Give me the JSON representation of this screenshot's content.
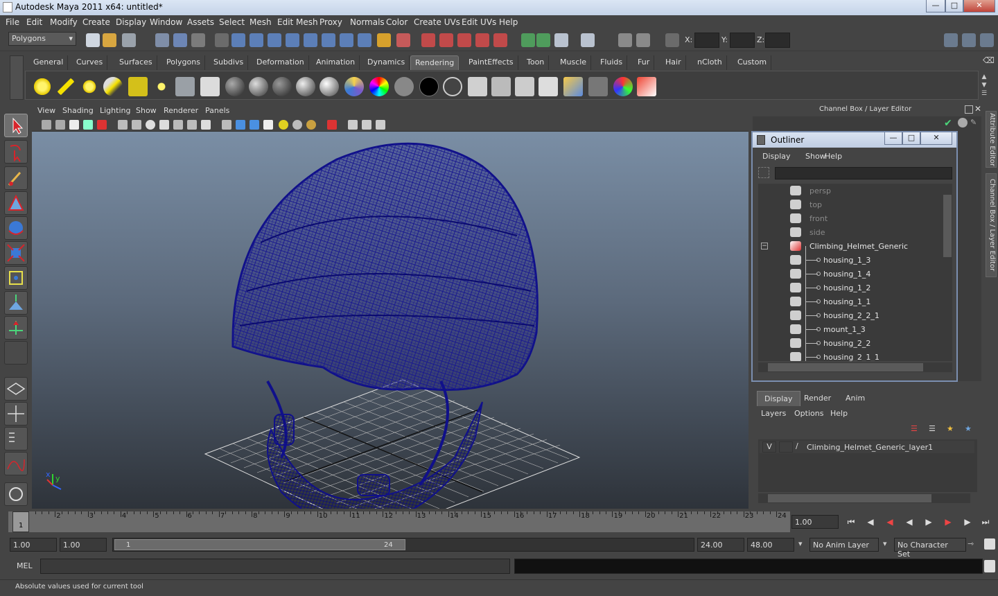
{
  "window": {
    "title": "Autodesk Maya 2011 x64: untitled*"
  },
  "menubar": [
    "File",
    "Edit",
    "Modify",
    "Create",
    "Display",
    "Window",
    "Assets",
    "Select",
    "Mesh",
    "Edit Mesh",
    "Proxy",
    "Normals",
    "Color",
    "Create UVs",
    "Edit UVs",
    "Help"
  ],
  "statusline": {
    "mode": "Polygons",
    "x_label": "X:",
    "y_label": "Y:",
    "z_label": "Z:"
  },
  "shelf_tabs": [
    "General",
    "Curves",
    "Surfaces",
    "Polygons",
    "Subdivs",
    "Deformation",
    "Animation",
    "Dynamics",
    "Rendering",
    "PaintEffects",
    "Toon",
    "Muscle",
    "Fluids",
    "Fur",
    "Hair",
    "nCloth",
    "Custom"
  ],
  "active_shelf": "Rendering",
  "viewport": {
    "menu": [
      "View",
      "Shading",
      "Lighting",
      "Show",
      "Renderer",
      "Panels"
    ],
    "axis_x": "x",
    "axis_y": "y"
  },
  "channel_box": {
    "title": "Channel Box / Layer Editor"
  },
  "outliner": {
    "title": "Outliner",
    "menu": [
      "Display",
      "Show",
      "Help"
    ],
    "items": [
      {
        "name": "persp",
        "dim": true,
        "level": 0
      },
      {
        "name": "top",
        "dim": true,
        "level": 0
      },
      {
        "name": "front",
        "dim": true,
        "level": 0
      },
      {
        "name": "side",
        "dim": true,
        "level": 0
      },
      {
        "name": "Climbing_Helmet_Generic",
        "dim": false,
        "level": 0
      },
      {
        "name": "housing_1_3",
        "dim": false,
        "level": 1
      },
      {
        "name": "housing_1_4",
        "dim": false,
        "level": 1
      },
      {
        "name": "housing_1_2",
        "dim": false,
        "level": 1
      },
      {
        "name": "housing_1_1",
        "dim": false,
        "level": 1
      },
      {
        "name": "housing_2_2_1",
        "dim": false,
        "level": 1
      },
      {
        "name": "mount_1_3",
        "dim": false,
        "level": 1
      },
      {
        "name": "housing_2_2",
        "dim": false,
        "level": 1
      },
      {
        "name": "housing_2_1_1",
        "dim": false,
        "level": 1
      }
    ]
  },
  "side_tabs": [
    "Attribute Editor",
    "Channel Box / Layer Editor"
  ],
  "layer_editor": {
    "tabs": [
      "Display",
      "Render",
      "Anim"
    ],
    "menu": [
      "Layers",
      "Options",
      "Help"
    ],
    "layer": {
      "visible": "V",
      "name": "Climbing_Helmet_Generic_layer1"
    }
  },
  "timeline": {
    "ticks": [
      "1",
      "2",
      "3",
      "4",
      "5",
      "6",
      "7",
      "8",
      "9",
      "10",
      "11",
      "12",
      "13",
      "14",
      "15",
      "16",
      "17",
      "18",
      "19",
      "20",
      "21",
      "22",
      "23",
      "24"
    ],
    "current": "1",
    "current_time": "1.00"
  },
  "range": {
    "start": "1.00",
    "playback_start": "1.00",
    "slider_start": "1",
    "slider_end": "24",
    "playback_end": "24.00",
    "end": "48.00",
    "anim_layer": "No Anim Layer",
    "char_set": "No Character Set"
  },
  "cmdline": {
    "label": "MEL"
  },
  "helpline": {
    "text": "Absolute values used for current tool"
  }
}
